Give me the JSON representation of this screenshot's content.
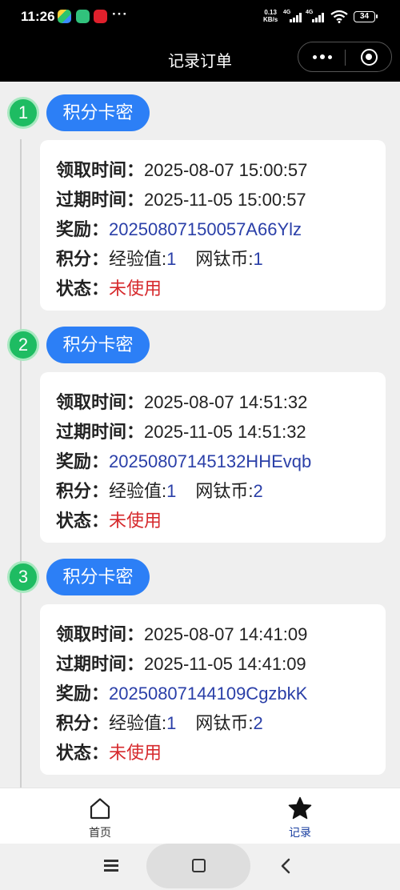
{
  "status_bar": {
    "time": "11:26",
    "more": "···",
    "net_speed_value": "0.13",
    "net_speed_unit": "KB/s",
    "signal1": "4G",
    "signal2": "4G",
    "battery": "34"
  },
  "nav": {
    "title": "记录订单"
  },
  "labels": {
    "claim_time": "领取时间：",
    "expire_time": "过期时间：",
    "reward": "奖励：",
    "points": "积分：",
    "exp": "经验值:",
    "coin": "网钛币:",
    "status": "状态："
  },
  "records": [
    {
      "index": "1",
      "tag": "积分卡密",
      "claim_time": "2025-08-07 15:00:57",
      "expire_time": "2025-11-05 15:00:57",
      "reward_code": "20250807150057A66Ylz",
      "exp_value": "1",
      "coin_value": "1",
      "status": "未使用"
    },
    {
      "index": "2",
      "tag": "积分卡密",
      "claim_time": "2025-08-07 14:51:32",
      "expire_time": "2025-11-05 14:51:32",
      "reward_code": "20250807145132HHEvqb",
      "exp_value": "1",
      "coin_value": "2",
      "status": "未使用"
    },
    {
      "index": "3",
      "tag": "积分卡密",
      "claim_time": "2025-08-07 14:41:09",
      "expire_time": "2025-11-05 14:41:09",
      "reward_code": "20250807144109CgzbkK",
      "exp_value": "1",
      "coin_value": "2",
      "status": "未使用"
    }
  ],
  "tab_bar": {
    "home_label": "首页",
    "records_label": "记录",
    "active_color": "#1a3fa0"
  },
  "colors": {
    "tag_blue": "#2c7ff6",
    "index_green": "#1ebc62",
    "code_blue": "#2a3fa8",
    "status_red": "#d6292c"
  }
}
